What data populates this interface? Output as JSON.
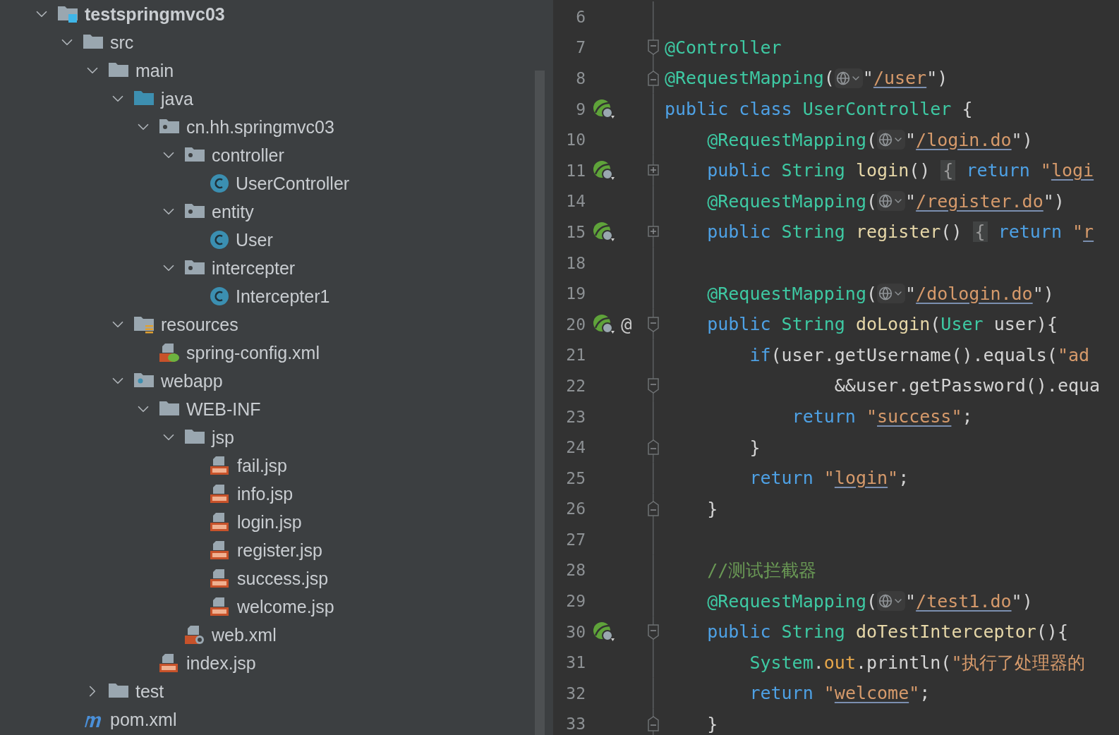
{
  "project_tree": [
    {
      "name": "testspringmvc03",
      "kind": "module",
      "expanded": true,
      "children": [
        {
          "name": "src",
          "kind": "folder",
          "expanded": true,
          "children": [
            {
              "name": "main",
              "kind": "folder",
              "expanded": true,
              "children": [
                {
                  "name": "java",
                  "kind": "source-folder",
                  "expanded": true,
                  "children": [
                    {
                      "name": "cn.hh.springmvc03",
                      "kind": "package",
                      "expanded": true,
                      "children": [
                        {
                          "name": "controller",
                          "kind": "package",
                          "expanded": true,
                          "children": [
                            {
                              "name": "UserController",
                              "kind": "class"
                            }
                          ]
                        },
                        {
                          "name": "entity",
                          "kind": "package",
                          "expanded": true,
                          "children": [
                            {
                              "name": "User",
                              "kind": "class"
                            }
                          ]
                        },
                        {
                          "name": "intercepter",
                          "kind": "package",
                          "expanded": true,
                          "children": [
                            {
                              "name": "Intercepter1",
                              "kind": "class"
                            }
                          ]
                        }
                      ]
                    }
                  ]
                },
                {
                  "name": "resources",
                  "kind": "resources",
                  "expanded": true,
                  "children": [
                    {
                      "name": "spring-config.xml",
                      "kind": "spring-xml"
                    }
                  ]
                },
                {
                  "name": "webapp",
                  "kind": "webapp",
                  "expanded": true,
                  "children": [
                    {
                      "name": "WEB-INF",
                      "kind": "folder",
                      "expanded": true,
                      "children": [
                        {
                          "name": "jsp",
                          "kind": "folder",
                          "expanded": true,
                          "children": [
                            {
                              "name": "fail.jsp",
                              "kind": "jsp"
                            },
                            {
                              "name": "info.jsp",
                              "kind": "jsp"
                            },
                            {
                              "name": "login.jsp",
                              "kind": "jsp"
                            },
                            {
                              "name": "register.jsp",
                              "kind": "jsp"
                            },
                            {
                              "name": "success.jsp",
                              "kind": "jsp"
                            },
                            {
                              "name": "welcome.jsp",
                              "kind": "jsp"
                            }
                          ]
                        },
                        {
                          "name": "web.xml",
                          "kind": "web-xml"
                        }
                      ]
                    },
                    {
                      "name": "index.jsp",
                      "kind": "jsp"
                    }
                  ]
                }
              ]
            },
            {
              "name": "test",
              "kind": "folder",
              "expanded": false
            }
          ]
        },
        {
          "name": "pom.xml",
          "kind": "maven"
        }
      ]
    }
  ],
  "editor": {
    "lines": [
      {
        "number": "6"
      },
      {
        "number": "7",
        "fold": {
          "kind": "start"
        },
        "tokens": [
          {
            "kind": "ann",
            "text": "@Controller"
          }
        ]
      },
      {
        "number": "8",
        "fold": {
          "kind": "end"
        },
        "tokens": [
          {
            "kind": "ann",
            "text": "@RequestMapping"
          },
          {
            "kind": "plain",
            "text": "("
          },
          {
            "kind": "globe"
          },
          {
            "kind": "plain",
            "text": "\""
          },
          {
            "kind": "url",
            "text": "/user"
          },
          {
            "kind": "plain",
            "text": "\")"
          }
        ]
      },
      {
        "number": "9",
        "gutter": [
          {
            "kind": "bean"
          }
        ],
        "tokens": [
          {
            "kind": "kw",
            "text": "public class "
          },
          {
            "kind": "type",
            "text": "UserController"
          },
          {
            "kind": "plain",
            "text": " {"
          }
        ]
      },
      {
        "number": "10",
        "tokens": [
          {
            "kind": "ann",
            "text": "    @RequestMapping"
          },
          {
            "kind": "plain",
            "text": "("
          },
          {
            "kind": "globe"
          },
          {
            "kind": "plain",
            "text": "\""
          },
          {
            "kind": "url",
            "text": "/login.do"
          },
          {
            "kind": "plain",
            "text": "\")"
          }
        ]
      },
      {
        "number": "11",
        "gutter": [
          {
            "kind": "bean"
          }
        ],
        "fold": {
          "kind": "collapsed"
        },
        "tokens": [
          {
            "kind": "kw",
            "text": "    public "
          },
          {
            "kind": "type",
            "text": "String "
          },
          {
            "kind": "method",
            "text": "login"
          },
          {
            "kind": "plain",
            "text": "() "
          },
          {
            "kind": "folded",
            "text": "{"
          },
          {
            "kind": "kw",
            "text": " return "
          },
          {
            "kind": "str",
            "text": "\""
          },
          {
            "kind": "url",
            "text": "logi"
          }
        ]
      },
      {
        "number": "14",
        "tokens": [
          {
            "kind": "ann",
            "text": "    @RequestMapping"
          },
          {
            "kind": "plain",
            "text": "("
          },
          {
            "kind": "globe"
          },
          {
            "kind": "plain",
            "text": "\""
          },
          {
            "kind": "url",
            "text": "/register.do"
          },
          {
            "kind": "plain",
            "text": "\")"
          }
        ]
      },
      {
        "number": "15",
        "gutter": [
          {
            "kind": "bean"
          }
        ],
        "fold": {
          "kind": "collapsed"
        },
        "tokens": [
          {
            "kind": "kw",
            "text": "    public "
          },
          {
            "kind": "type",
            "text": "String "
          },
          {
            "kind": "method",
            "text": "register"
          },
          {
            "kind": "plain",
            "text": "() "
          },
          {
            "kind": "folded",
            "text": "{"
          },
          {
            "kind": "kw",
            "text": " return "
          },
          {
            "kind": "str",
            "text": "\""
          },
          {
            "kind": "url",
            "text": "r"
          }
        ]
      },
      {
        "number": "18"
      },
      {
        "number": "19",
        "tokens": [
          {
            "kind": "ann",
            "text": "    @RequestMapping"
          },
          {
            "kind": "plain",
            "text": "("
          },
          {
            "kind": "globe"
          },
          {
            "kind": "plain",
            "text": "\""
          },
          {
            "kind": "url",
            "text": "/dologin.do"
          },
          {
            "kind": "plain",
            "text": "\")"
          }
        ]
      },
      {
        "number": "20",
        "gutter": [
          {
            "kind": "bean"
          },
          {
            "kind": "at",
            "text": "@"
          }
        ],
        "fold": {
          "kind": "start"
        },
        "tokens": [
          {
            "kind": "kw",
            "text": "    public "
          },
          {
            "kind": "type",
            "text": "String "
          },
          {
            "kind": "method",
            "text": "doLogin"
          },
          {
            "kind": "plain",
            "text": "("
          },
          {
            "kind": "type",
            "text": "User "
          },
          {
            "kind": "plain",
            "text": "user){"
          }
        ]
      },
      {
        "number": "21",
        "tokens": [
          {
            "kind": "kw",
            "text": "        if"
          },
          {
            "kind": "plain",
            "text": "(user.getUsername().equals("
          },
          {
            "kind": "str",
            "text": "\"ad"
          }
        ]
      },
      {
        "number": "22",
        "fold": {
          "kind": "start"
        },
        "tokens": [
          {
            "kind": "plain",
            "text": "                &&user.getPassword().equa"
          }
        ]
      },
      {
        "number": "23",
        "tokens": [
          {
            "kind": "kw",
            "text": "            return "
          },
          {
            "kind": "str",
            "text": "\""
          },
          {
            "kind": "url",
            "text": "success"
          },
          {
            "kind": "str",
            "text": "\""
          },
          {
            "kind": "plain",
            "text": ";"
          }
        ]
      },
      {
        "number": "24",
        "fold": {
          "kind": "end"
        },
        "tokens": [
          {
            "kind": "plain",
            "text": "        }"
          }
        ]
      },
      {
        "number": "25",
        "tokens": [
          {
            "kind": "kw",
            "text": "        return "
          },
          {
            "kind": "str",
            "text": "\""
          },
          {
            "kind": "url",
            "text": "login"
          },
          {
            "kind": "str",
            "text": "\""
          },
          {
            "kind": "plain",
            "text": ";"
          }
        ]
      },
      {
        "number": "26",
        "fold": {
          "kind": "end"
        },
        "tokens": [
          {
            "kind": "plain",
            "text": "    }"
          }
        ]
      },
      {
        "number": "27"
      },
      {
        "number": "28",
        "tokens": [
          {
            "kind": "comment",
            "text": "    //测试拦截器"
          }
        ]
      },
      {
        "number": "29",
        "tokens": [
          {
            "kind": "ann",
            "text": "    @RequestMapping"
          },
          {
            "kind": "plain",
            "text": "("
          },
          {
            "kind": "globe"
          },
          {
            "kind": "plain",
            "text": "\""
          },
          {
            "kind": "url",
            "text": "/test1.do"
          },
          {
            "kind": "plain",
            "text": "\")"
          }
        ]
      },
      {
        "number": "30",
        "gutter": [
          {
            "kind": "bean"
          }
        ],
        "fold": {
          "kind": "start"
        },
        "tokens": [
          {
            "kind": "kw",
            "text": "    public "
          },
          {
            "kind": "type",
            "text": "String "
          },
          {
            "kind": "method",
            "text": "doTestInterceptor"
          },
          {
            "kind": "plain",
            "text": "(){"
          }
        ]
      },
      {
        "number": "31",
        "tokens": [
          {
            "kind": "type",
            "text": "        System"
          },
          {
            "kind": "plain",
            "text": "."
          },
          {
            "kind": "field",
            "text": "out"
          },
          {
            "kind": "plain",
            "text": ".println("
          },
          {
            "kind": "str",
            "text": "\"执行了处理器的"
          }
        ]
      },
      {
        "number": "32",
        "tokens": [
          {
            "kind": "kw",
            "text": "        return "
          },
          {
            "kind": "str",
            "text": "\""
          },
          {
            "kind": "url",
            "text": "welcome"
          },
          {
            "kind": "str",
            "text": "\""
          },
          {
            "kind": "plain",
            "text": ";"
          }
        ]
      },
      {
        "number": "33",
        "fold": {
          "kind": "end"
        },
        "tokens": [
          {
            "kind": "plain",
            "text": "    }"
          }
        ]
      }
    ]
  }
}
